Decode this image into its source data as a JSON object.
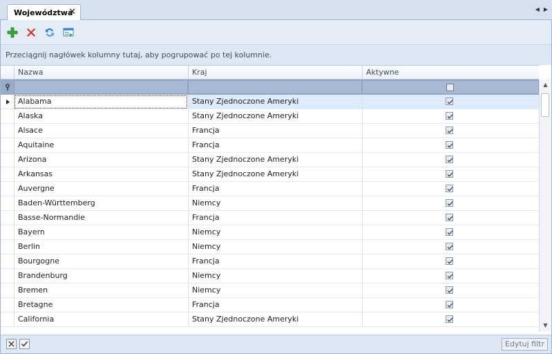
{
  "tab": {
    "title": "Województwa",
    "close_glyph": "✕"
  },
  "nav": {
    "prev_glyph": "◀",
    "next_glyph": "▶"
  },
  "toolbar": {
    "buttons": [
      {
        "name": "add-icon",
        "color": "#3aa63a"
      },
      {
        "name": "delete-icon",
        "color": "#d8301f"
      },
      {
        "name": "refresh-icon",
        "color": "#2a7fd4"
      },
      {
        "name": "export-icon",
        "color": "#3d86c6"
      }
    ]
  },
  "group_panel": {
    "text": "Przeciągnij nagłówek kolumny tutaj, aby pogrupować po tej kolumnie."
  },
  "columns": {
    "name": "Nazwa",
    "country": "Kraj",
    "active": "Aktywne"
  },
  "rows": [
    {
      "name": "Alabama",
      "country": "Stany Zjednoczone Ameryki",
      "active": true
    },
    {
      "name": "Alaska",
      "country": "Stany Zjednoczone Ameryki",
      "active": true
    },
    {
      "name": "Alsace",
      "country": "Francja",
      "active": true
    },
    {
      "name": "Aquitaine",
      "country": "Francja",
      "active": true
    },
    {
      "name": "Arizona",
      "country": "Stany Zjednoczone Ameryki",
      "active": true
    },
    {
      "name": "Arkansas",
      "country": "Stany Zjednoczone Ameryki",
      "active": true
    },
    {
      "name": "Auvergne",
      "country": "Francja",
      "active": true
    },
    {
      "name": "Baden-Württemberg",
      "country": "Niemcy",
      "active": true
    },
    {
      "name": "Basse-Normandie",
      "country": "Francja",
      "active": true
    },
    {
      "name": "Bayern",
      "country": "Niemcy",
      "active": true
    },
    {
      "name": "Berlin",
      "country": "Niemcy",
      "active": true
    },
    {
      "name": "Bourgogne",
      "country": "Francja",
      "active": true
    },
    {
      "name": "Brandenburg",
      "country": "Niemcy",
      "active": true
    },
    {
      "name": "Bremen",
      "country": "Niemcy",
      "active": true
    },
    {
      "name": "Bretagne",
      "country": "Francja",
      "active": true
    },
    {
      "name": "California",
      "country": "Stany Zjednoczone Ameryki",
      "active": true
    }
  ],
  "statusbar": {
    "edit_filter_label": "Edytuj filtr"
  },
  "colors": {
    "accent": "#9fb3cf",
    "selected_row": "#ddebfb",
    "filter_row": "#97abc9"
  }
}
